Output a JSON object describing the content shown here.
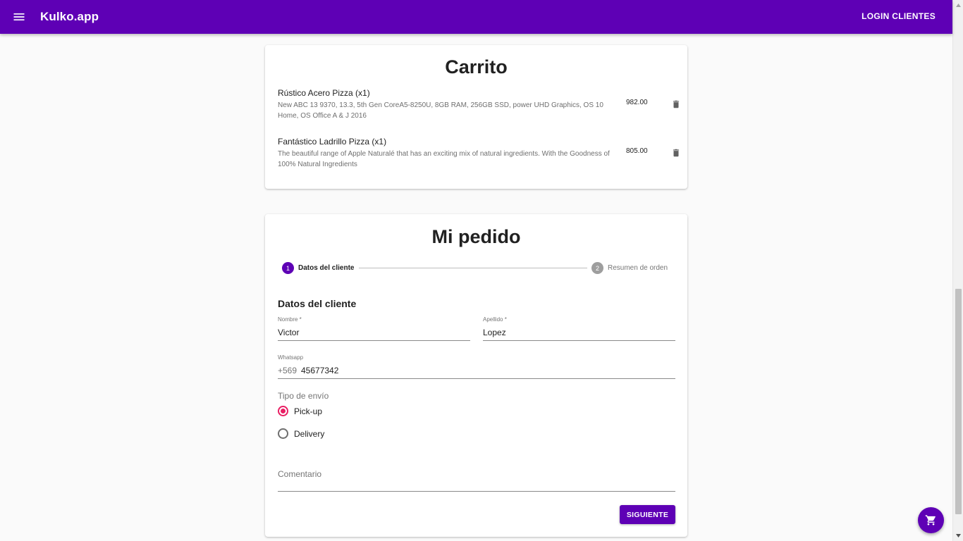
{
  "appbar": {
    "menu_icon": "menu-icon",
    "brand": "Kulko.app",
    "login_label": "LOGIN CLIENTES"
  },
  "cart": {
    "title": "Carrito",
    "items": [
      {
        "name": "Rústico Acero Pizza (x1)",
        "description": "New ABC 13 9370, 13.3, 5th Gen CoreA5-8250U, 8GB RAM, 256GB SSD, power UHD Graphics, OS 10 Home, OS Office A & J 2016",
        "price": "982.00",
        "delete_icon": "trash-icon"
      },
      {
        "name": "Fantástico Ladrillo Pizza (x1)",
        "description": "The beautiful range of Apple Naturalé that has an exciting mix of natural ingredients. With the Goodness of 100% Natural Ingredients",
        "price": "805.00",
        "delete_icon": "trash-icon"
      }
    ]
  },
  "order": {
    "title": "Mi pedido",
    "steps": [
      {
        "number": "1",
        "label": "Datos del cliente",
        "active": true
      },
      {
        "number": "2",
        "label": "Resumen de orden",
        "active": false
      }
    ],
    "section_heading": "Datos del cliente",
    "fields": {
      "nombre": {
        "label": "Nombre *",
        "value": "Victor"
      },
      "apellido": {
        "label": "Apellido *",
        "value": "Lopez"
      },
      "whatsapp": {
        "label": "Whatsapp",
        "prefix": "+569",
        "value": "45677342"
      },
      "comentario": {
        "placeholder": "Comentario",
        "value": ""
      }
    },
    "shipping": {
      "label": "Tipo de envío",
      "options": [
        {
          "label": "Pick-up",
          "checked": true
        },
        {
          "label": "Delivery",
          "checked": false
        }
      ]
    },
    "next_label": "SIGUIENTE"
  },
  "fab": {
    "icon": "cart-icon"
  },
  "colors": {
    "primary": "#5e00b5",
    "accent": "#e91e63",
    "step_inactive": "#9e9e9e"
  }
}
